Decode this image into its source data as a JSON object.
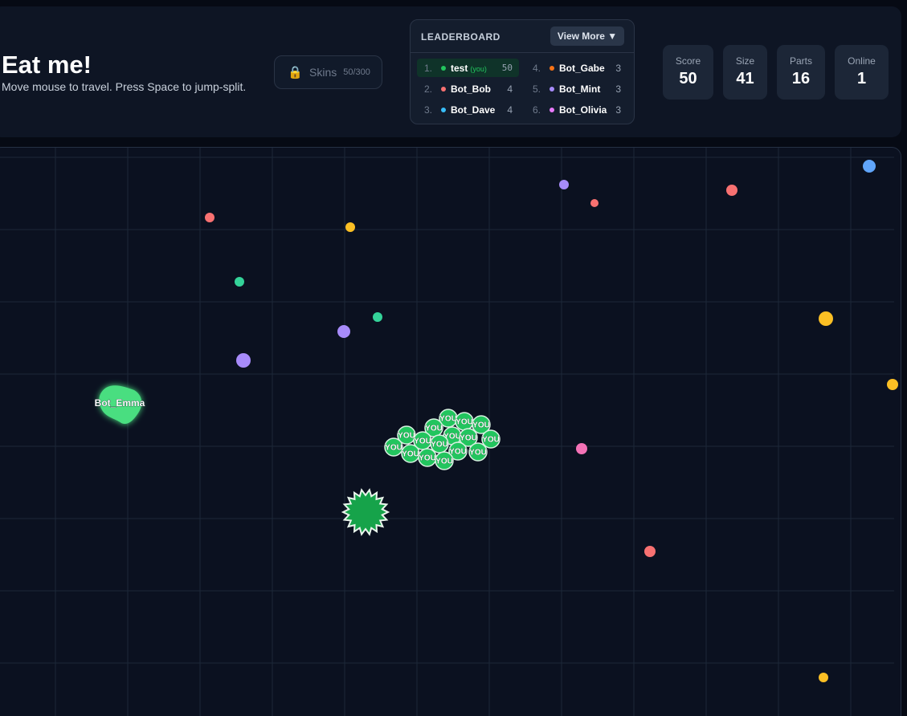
{
  "header": {
    "title": "Eat me!",
    "subtitle": "Move mouse to travel. Press Space to jump-split."
  },
  "skins": {
    "icon": "lock-icon",
    "label": "Skins",
    "count": "50/300"
  },
  "leaderboard": {
    "title": "LEADERBOARD",
    "view_more": "View More ▼",
    "entries": [
      {
        "rank": "1.",
        "name": "test",
        "tag": "(you)",
        "score": "50",
        "color": "#22c55e"
      },
      {
        "rank": "2.",
        "name": "Bot_Bob",
        "score": "4",
        "color": "#f87171"
      },
      {
        "rank": "3.",
        "name": "Bot_Dave",
        "score": "4",
        "color": "#38bdf8"
      },
      {
        "rank": "4.",
        "name": "Bot_Gabe",
        "score": "3",
        "color": "#f97316"
      },
      {
        "rank": "5.",
        "name": "Bot_Mint",
        "score": "3",
        "color": "#a78bfa"
      },
      {
        "rank": "6.",
        "name": "Bot_Olivia",
        "score": "3",
        "color": "#e879f9"
      }
    ]
  },
  "stats": [
    {
      "label": "Score",
      "value": "50"
    },
    {
      "label": "Size",
      "value": "41"
    },
    {
      "label": "Parts",
      "value": "16"
    },
    {
      "label": "Online",
      "value": "1"
    }
  ],
  "game": {
    "player_label": "YOU",
    "player_color": "#22c55e",
    "bot_name": "Bot_Emma",
    "bot_color": "#4ade80",
    "virus_color": "#16a34a",
    "food_colors": [
      "#f87171",
      "#fbbf24",
      "#34d399",
      "#a78bfa",
      "#60a5fa",
      "#f472b6"
    ]
  }
}
